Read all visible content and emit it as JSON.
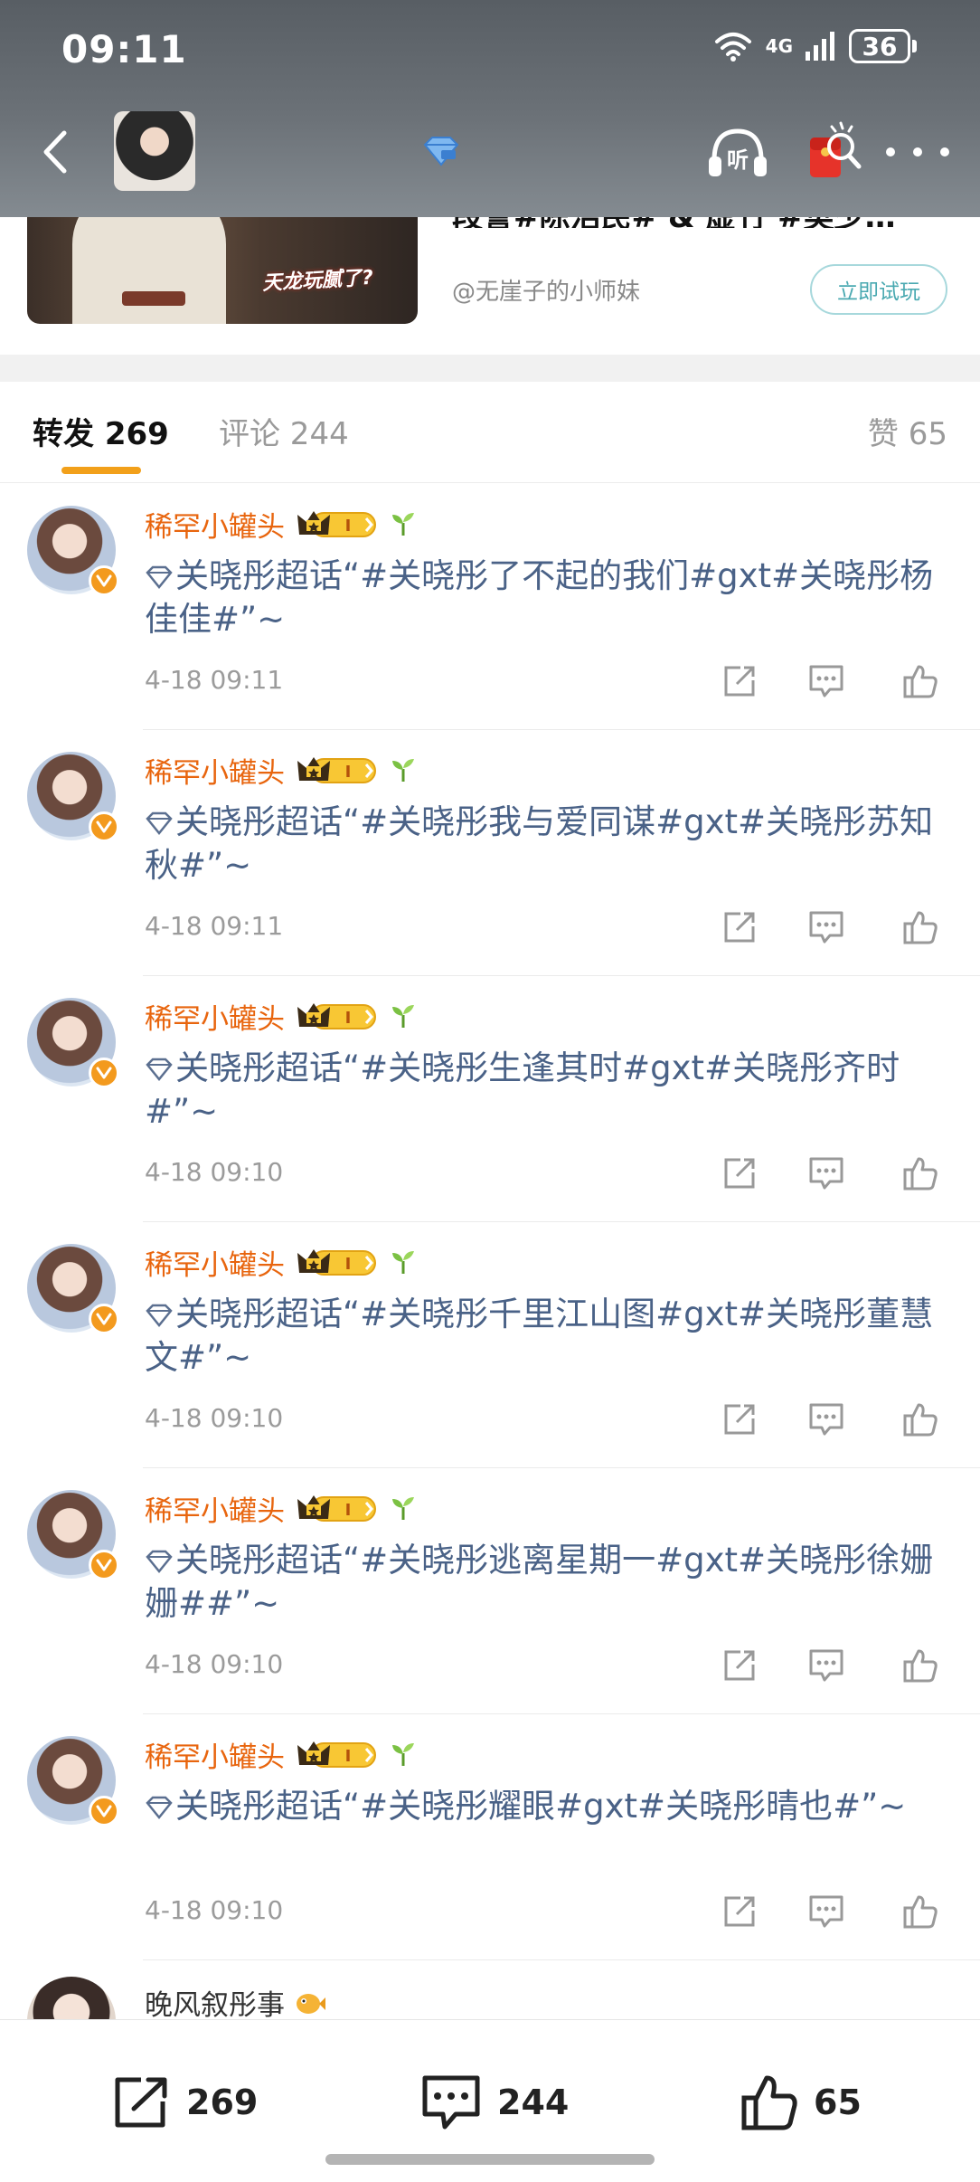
{
  "status_bar": {
    "time": "09:11",
    "network": "4G",
    "battery": "36"
  },
  "nav": {
    "listen_label": "听"
  },
  "source_card": {
    "title": "段誉#陈浩民# & 虚竹 #樊少…",
    "thumbnail_caption": "天龙玩腻了?",
    "author": "@无崖子的小师妹",
    "try_button": "立即试玩"
  },
  "tabs": {
    "repost": "转发 269",
    "comment": "评论 244",
    "like": "赞 65"
  },
  "reposts": [
    {
      "username": "稀罕小罐头",
      "text": "关晓彤超话“#关晓彤了不起的我们#gxt#关晓彤杨佳佳#”~",
      "time": "4-18 09:11"
    },
    {
      "username": "稀罕小罐头",
      "text": "关晓彤超话“#关晓彤我与爱同谋#gxt#关晓彤苏知秋#”~",
      "time": "4-18 09:11"
    },
    {
      "username": "稀罕小罐头",
      "text": "关晓彤超话“#关晓彤生逢其时#gxt#关晓彤齐时#”~",
      "time": "4-18 09:10"
    },
    {
      "username": "稀罕小罐头",
      "text": "关晓彤超话“#关晓彤千里江山图#gxt#关晓彤董慧文#”~",
      "time": "4-18 09:10"
    },
    {
      "username": "稀罕小罐头",
      "text": "关晓彤超话“#关晓彤逃离星期一#gxt#关晓彤徐姗姗##”~",
      "time": "4-18 09:10"
    },
    {
      "username": "稀罕小罐头",
      "text": "关晓彤超话“#关晓彤耀眼#gxt#关晓彤晴也#”~",
      "time": "4-18 09:10"
    }
  ],
  "partial_repost": {
    "username": "晚风叙彤事"
  },
  "bottom_bar": {
    "repost_count": "269",
    "comment_count": "244",
    "like_count": "65"
  },
  "colors": {
    "username": "#e8650e",
    "link_text": "#4a6287",
    "tab_indicator": "#f2a01a",
    "try_button": "#4aa9b1"
  }
}
